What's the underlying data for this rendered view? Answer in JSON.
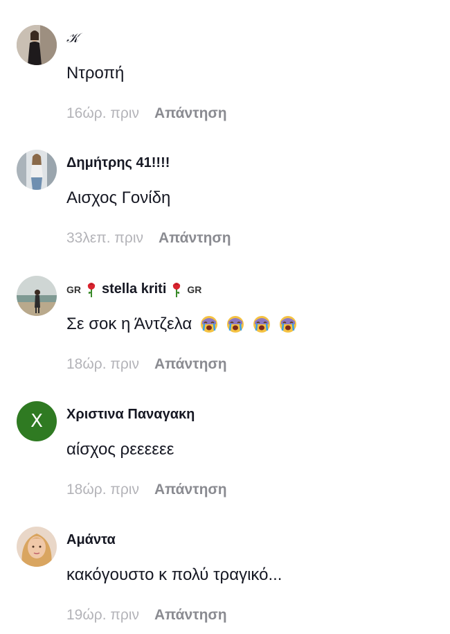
{
  "comments": [
    {
      "username": "𝒦",
      "text": "Ντροπή",
      "time": "16ώρ. πριν",
      "reply_label": "Απάντηση",
      "avatar": "photo-woman-dark-dress"
    },
    {
      "username": "Δημήτρης 41!!!!",
      "text": "Αισχος Γονίδη",
      "time": "33λεπ. πριν",
      "reply_label": "Απάντηση",
      "avatar": "photo-woman-standing"
    },
    {
      "username_prefix": "GR",
      "username": "stella kriti",
      "username_suffix": "GR",
      "username_icon": "rose-icon",
      "text": "Σε σοκ η Άντζελα",
      "emoji": [
        "crying-face-icon",
        "crying-face-icon",
        "crying-face-icon",
        "crying-face-icon"
      ],
      "time": "18ώρ. πριν",
      "reply_label": "Απάντηση",
      "avatar": "photo-person-by-sea"
    },
    {
      "username": "Χριστινα Παναγακη",
      "text": "αίσχος ρεεεεεε",
      "time": "18ώρ. πριν",
      "reply_label": "Απάντηση",
      "avatar_letter": "X",
      "avatar_color": "#2f7a22"
    },
    {
      "username": "Αμάντα",
      "text": "κακόγουστο κ πολύ τραγικό...",
      "time": "19ώρ. πριν",
      "reply_label": "Απάντηση",
      "avatar": "photo-woman-blonde"
    }
  ]
}
